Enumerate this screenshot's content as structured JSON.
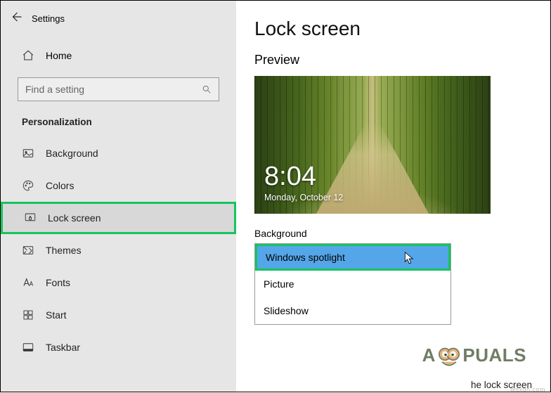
{
  "header": {
    "title": "Settings"
  },
  "sidebar": {
    "home_label": "Home",
    "search_placeholder": "Find a setting",
    "section_title": "Personalization",
    "items": [
      {
        "label": "Background"
      },
      {
        "label": "Colors"
      },
      {
        "label": "Lock screen"
      },
      {
        "label": "Themes"
      },
      {
        "label": "Fonts"
      },
      {
        "label": "Start"
      },
      {
        "label": "Taskbar"
      }
    ]
  },
  "main": {
    "page_title": "Lock screen",
    "preview_label": "Preview",
    "clock_time": "8:04",
    "clock_date": "Monday, October 12",
    "background_label": "Background",
    "dropdown": {
      "options": [
        {
          "label": "Windows spotlight"
        },
        {
          "label": "Picture"
        },
        {
          "label": "Slideshow"
        }
      ],
      "selected_index": 0
    },
    "truncated_text": "he lock screen"
  },
  "watermark": {
    "brand": "A  PUALS",
    "source": "wsxdn.com"
  }
}
